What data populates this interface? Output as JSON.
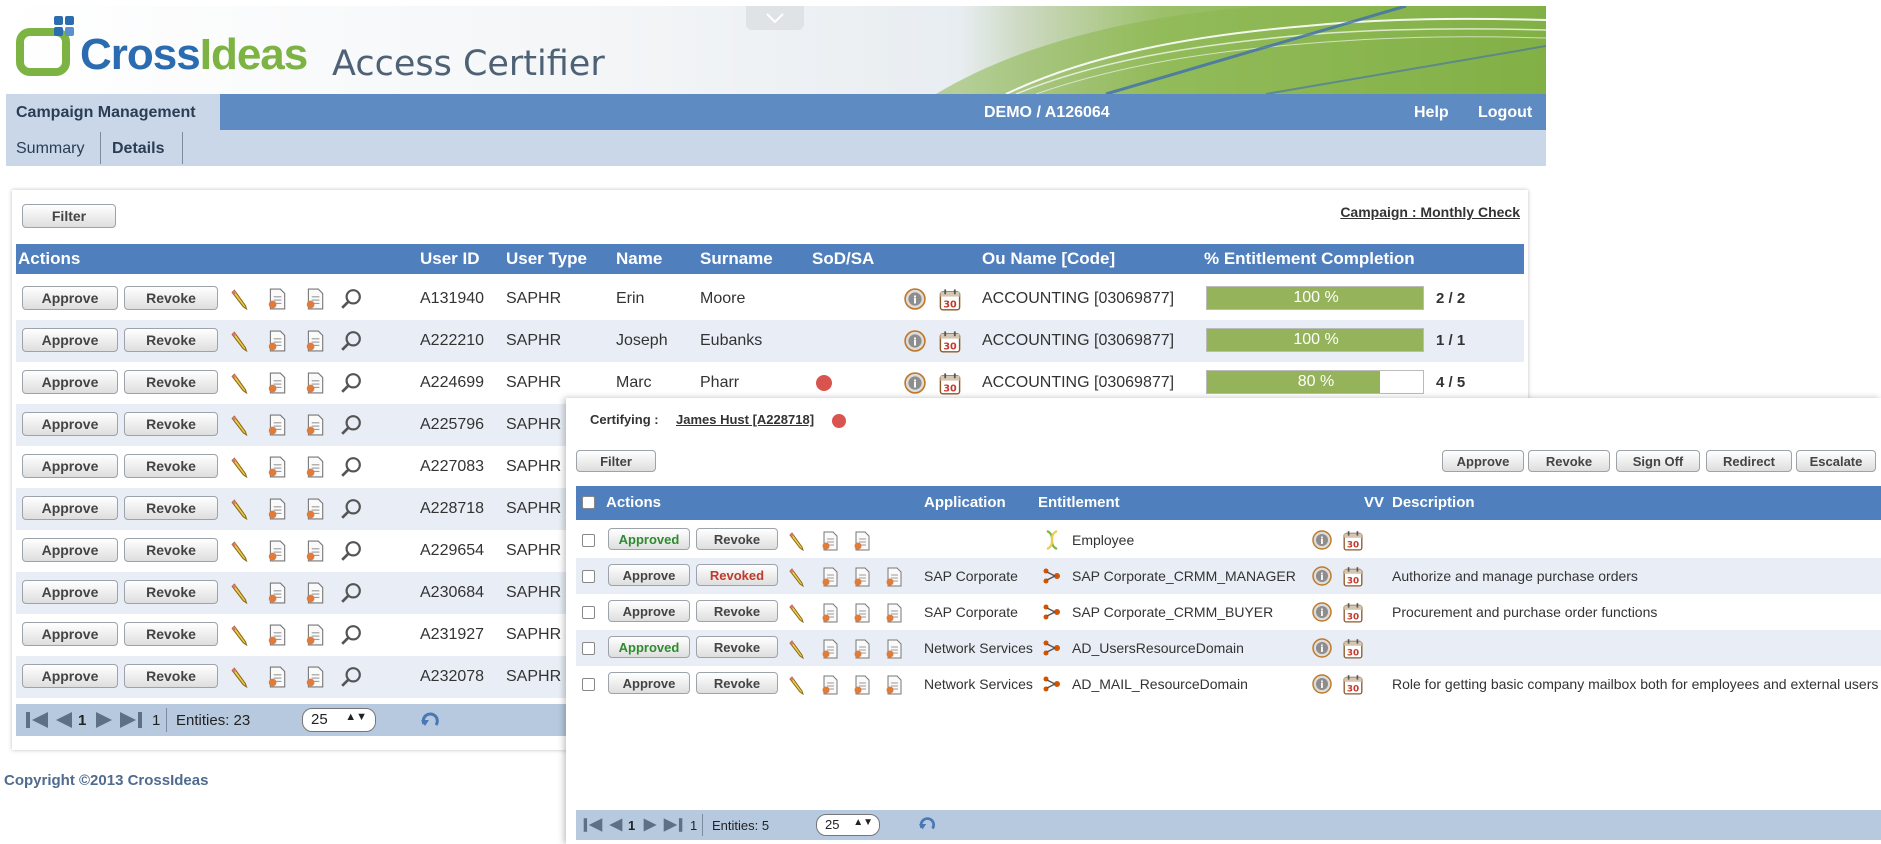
{
  "app": {
    "logo_part1": "Cross",
    "logo_part2": "Ideas",
    "title": "Access Certifier"
  },
  "nav": {
    "campaign_management": "Campaign Management",
    "environment": "DEMO / A126064",
    "help": "Help",
    "logout": "Logout",
    "tabs": [
      {
        "label": "Summary",
        "active": false
      },
      {
        "label": "Details",
        "active": true
      }
    ]
  },
  "main": {
    "filter_label": "Filter",
    "campaign_link": "Campaign : Monthly Check",
    "headers": {
      "actions": "Actions",
      "user_id": "User ID",
      "user_type": "User Type",
      "name": "Name",
      "surname": "Surname",
      "sod": "SoD/SA",
      "ou_name": "Ou Name [Code]",
      "completion": "% Entitlement Completion"
    },
    "approve_label": "Approve",
    "revoke_label": "Revoke",
    "rows": [
      {
        "user_id": "A131940",
        "user_type": "SAPHR",
        "name": "Erin",
        "surname": "Moore",
        "sod": false,
        "ou": "ACCOUNTING [03069877]",
        "pct": 100,
        "pct_label": "100 %",
        "count": "2 / 2"
      },
      {
        "user_id": "A222210",
        "user_type": "SAPHR",
        "name": "Joseph",
        "surname": "Eubanks",
        "sod": false,
        "ou": "ACCOUNTING [03069877]",
        "pct": 100,
        "pct_label": "100 %",
        "count": "1 / 1"
      },
      {
        "user_id": "A224699",
        "user_type": "SAPHR",
        "name": "Marc",
        "surname": "Pharr",
        "sod": true,
        "ou": "ACCOUNTING [03069877]",
        "pct": 80,
        "pct_label": "80 %",
        "count": "4 / 5"
      },
      {
        "user_id": "A225796",
        "user_type": "SAPHR"
      },
      {
        "user_id": "A227083",
        "user_type": "SAPHR"
      },
      {
        "user_id": "A228718",
        "user_type": "SAPHR"
      },
      {
        "user_id": "A229654",
        "user_type": "SAPHR"
      },
      {
        "user_id": "A230684",
        "user_type": "SAPHR"
      },
      {
        "user_id": "A231927",
        "user_type": "SAPHR"
      },
      {
        "user_id": "A232078",
        "user_type": "SAPHR"
      }
    ],
    "pager": {
      "page": "1",
      "total_pages": "1",
      "entities": "Entities: 23",
      "page_size": "25"
    }
  },
  "detail": {
    "certifying_label": "Certifying :",
    "certifying_user": "James Hust [A228718]",
    "filter_label": "Filter",
    "bulk_buttons": [
      "Approve",
      "Revoke",
      "Sign Off",
      "Redirect",
      "Escalate"
    ],
    "headers": {
      "actions": "Actions",
      "application": "Application",
      "entitlement": "Entitlement",
      "vv": "VV",
      "description": "Description"
    },
    "rows": [
      {
        "approve": "Approved",
        "approve_state": "approved",
        "revoke": "Revoke",
        "revoke_state": "none",
        "application": "",
        "entitlement": "Employee",
        "ent_icon": "role",
        "description": "",
        "icons": 3
      },
      {
        "approve": "Approve",
        "approve_state": "none",
        "revoke": "Revoked",
        "revoke_state": "revoked",
        "application": "SAP Corporate",
        "entitlement": "SAP Corporate_CRMM_MANAGER",
        "ent_icon": "permission",
        "description": "Authorize and manage purchase orders",
        "icons": 4
      },
      {
        "approve": "Approve",
        "approve_state": "none",
        "revoke": "Revoke",
        "revoke_state": "none",
        "application": "SAP Corporate",
        "entitlement": "SAP Corporate_CRMM_BUYER",
        "ent_icon": "permission",
        "description": "Procurement and purchase order functions",
        "icons": 4
      },
      {
        "approve": "Approved",
        "approve_state": "approved",
        "revoke": "Revoke",
        "revoke_state": "none",
        "application": "Network Services",
        "entitlement": "AD_UsersResourceDomain",
        "ent_icon": "permission",
        "description": "",
        "icons": 4
      },
      {
        "approve": "Approve",
        "approve_state": "none",
        "revoke": "Revoke",
        "revoke_state": "none",
        "application": "Network Services",
        "entitlement": "AD_MAIL_ResourceDomain",
        "ent_icon": "permission",
        "description": "Role for getting basic company mailbox both for employees and external users",
        "icons": 4
      }
    ],
    "pager": {
      "page": "1",
      "total_pages": "1",
      "entities": "Entities: 5",
      "page_size": "25"
    }
  },
  "footer": {
    "copyright": "Copyright ©2013 CrossIdeas"
  },
  "colors": {
    "header_blue": "#4f7fbd",
    "nav_blue": "#5e8bc2",
    "light_blue": "#c9d7e9",
    "progress_green": "#95b35a",
    "sod_red": "#d9534f",
    "approved_green": "#2e8b2e",
    "revoked_red": "#c0392b"
  }
}
